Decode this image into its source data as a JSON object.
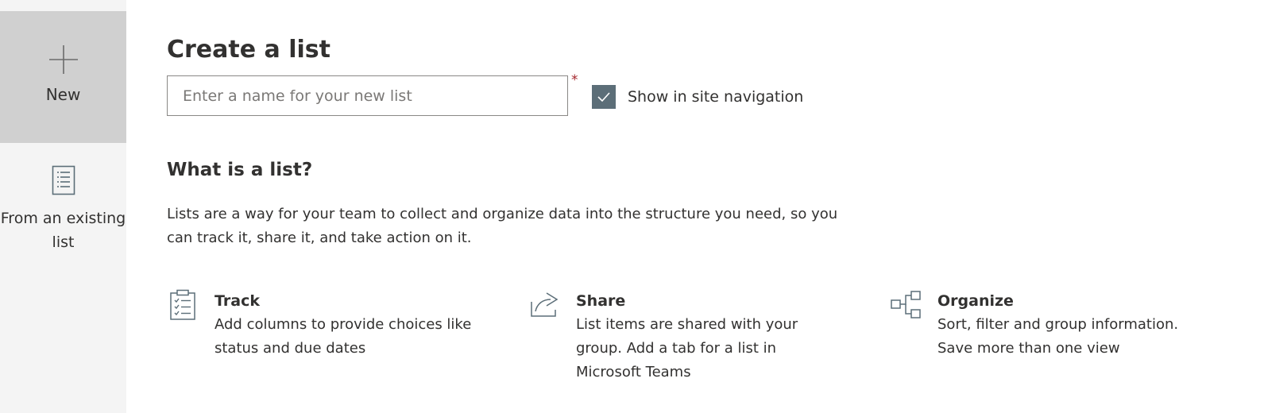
{
  "rail": {
    "new_label": "New",
    "existing_label": "From an existing list"
  },
  "form": {
    "title": "Create a list",
    "name_placeholder": "Enter a name for your new list",
    "name_value": "",
    "required_mark": "*",
    "show_in_nav_label": "Show in site navigation",
    "show_in_nav_checked": true
  },
  "info": {
    "heading": "What is a list?",
    "description": "Lists are a way for your team to collect and organize data into the structure you need, so you can track it, share it, and take action on it."
  },
  "features": [
    {
      "icon": "clipboard-checklist-icon",
      "title": "Track",
      "description": "Add columns to provide choices like status and due dates"
    },
    {
      "icon": "share-arrow-icon",
      "title": "Share",
      "description": "List items are shared with your group. Add a tab for a list in Microsoft Teams"
    },
    {
      "icon": "organize-flowchart-icon",
      "title": "Organize",
      "description": "Sort, filter and group information. Save more than one view"
    }
  ],
  "colors": {
    "rail_background": "#f4f4f4",
    "rail_selected": "#d0d0d0",
    "checkbox_fill": "#5c6e78",
    "required": "#a4262c",
    "icon_stroke": "#5c6e78"
  }
}
